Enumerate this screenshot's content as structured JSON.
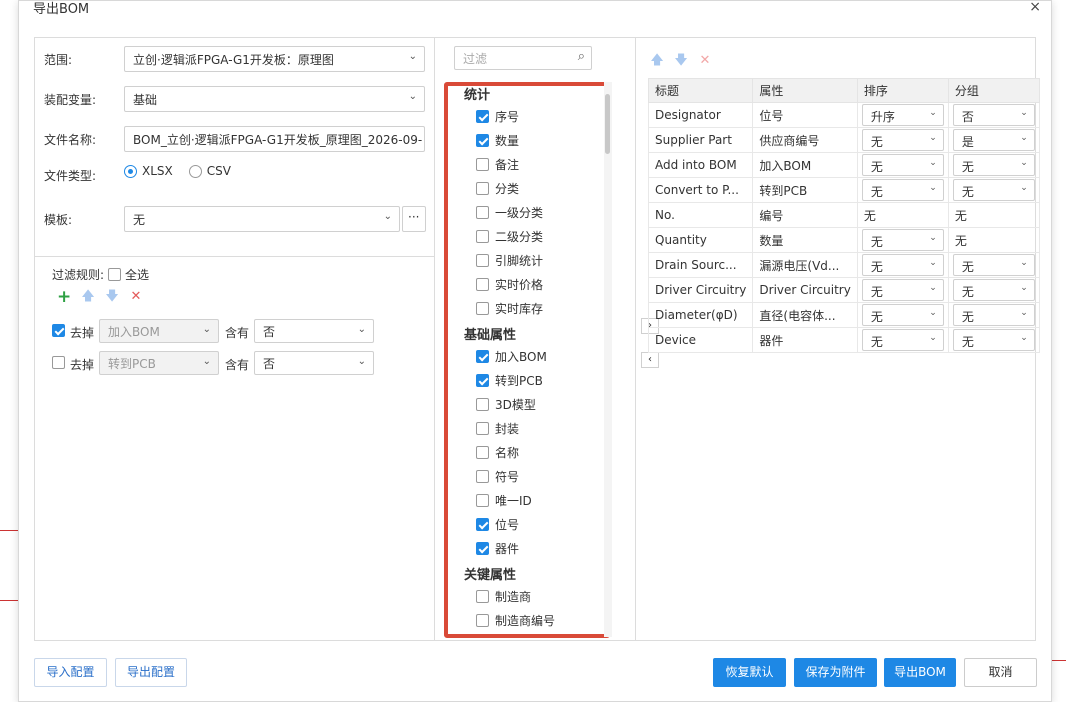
{
  "window": {
    "title": "导出BOM",
    "close_glyph": "×"
  },
  "form": {
    "range_label": "范围:",
    "range_value": "立创·逻辑派FPGA-G1开发板：原理图",
    "variant_label": "装配变量:",
    "variant_value": "基础",
    "filename_label": "文件名称:",
    "filename_value": "BOM_立创·逻辑派FPGA-G1开发板_原理图_2026-09-",
    "filetype_label": "文件类型:",
    "filetype_options": [
      "XLSX",
      "CSV"
    ],
    "filetype_selected": "XLSX",
    "template_label": "模板:",
    "template_value": "无",
    "template_more": "···"
  },
  "filter_rules": {
    "label": "过滤规则:",
    "select_all": "全选",
    "rules": [
      {
        "checked": true,
        "action": "去掉",
        "field": "加入BOM",
        "op": "含有",
        "value": "否"
      },
      {
        "checked": false,
        "action": "去掉",
        "field": "转到PCB",
        "op": "含有",
        "value": "否"
      }
    ]
  },
  "field_list": {
    "search_placeholder": "过滤",
    "groups": [
      {
        "name": "统计",
        "items": [
          {
            "label": "序号",
            "checked": true
          },
          {
            "label": "数量",
            "checked": true
          },
          {
            "label": "备注",
            "checked": false
          },
          {
            "label": "分类",
            "checked": false
          },
          {
            "label": "一级分类",
            "checked": false
          },
          {
            "label": "二级分类",
            "checked": false
          },
          {
            "label": "引脚统计",
            "checked": false
          },
          {
            "label": "实时价格",
            "checked": false
          },
          {
            "label": "实时库存",
            "checked": false
          }
        ]
      },
      {
        "name": "基础属性",
        "items": [
          {
            "label": "加入BOM",
            "checked": true
          },
          {
            "label": "转到PCB",
            "checked": true
          },
          {
            "label": "3D模型",
            "checked": false
          },
          {
            "label": "封装",
            "checked": false
          },
          {
            "label": "名称",
            "checked": false
          },
          {
            "label": "符号",
            "checked": false
          },
          {
            "label": "唯一ID",
            "checked": false
          },
          {
            "label": "位号",
            "checked": true
          },
          {
            "label": "器件",
            "checked": true
          }
        ]
      },
      {
        "name": "关键属性",
        "items": [
          {
            "label": "制造商",
            "checked": false
          },
          {
            "label": "制造商编号",
            "checked": false
          }
        ]
      }
    ]
  },
  "move_buttons": {
    "right": "›",
    "left": "‹"
  },
  "columns_table": {
    "headers": [
      "标题",
      "属性",
      "排序",
      "分组"
    ],
    "rows": [
      {
        "title": "Designator",
        "attr": "位号",
        "sort": "升序",
        "sort_sel": true,
        "group": "否",
        "group_sel": true
      },
      {
        "title": "Supplier Part",
        "attr": "供应商编号",
        "sort": "无",
        "sort_sel": true,
        "group": "是",
        "group_sel": true
      },
      {
        "title": "Add into BOM",
        "attr": "加入BOM",
        "sort": "无",
        "sort_sel": true,
        "group": "无",
        "group_sel": true
      },
      {
        "title": "Convert to P...",
        "attr": "转到PCB",
        "sort": "无",
        "sort_sel": true,
        "group": "无",
        "group_sel": true
      },
      {
        "title": "No.",
        "attr": "编号",
        "sort": "无",
        "sort_sel": false,
        "group": "无",
        "group_sel": false
      },
      {
        "title": "Quantity",
        "attr": "数量",
        "sort": "无",
        "sort_sel": true,
        "group": "无",
        "group_sel": false
      },
      {
        "title": "Drain Sourc...",
        "attr": "漏源电压(Vd...",
        "sort": "无",
        "sort_sel": true,
        "group": "无",
        "group_sel": true
      },
      {
        "title": "Driver Circuitry",
        "attr": "Driver Circuitry",
        "sort": "无",
        "sort_sel": true,
        "group": "无",
        "group_sel": true
      },
      {
        "title": "Diameter(φD)",
        "attr": "直径(电容体...",
        "sort": "无",
        "sort_sel": true,
        "group": "无",
        "group_sel": true
      },
      {
        "title": "Device",
        "attr": "器件",
        "sort": "无",
        "sort_sel": true,
        "group": "无",
        "group_sel": true
      }
    ]
  },
  "footer": {
    "import_config": "导入配置",
    "export_config": "导出配置",
    "restore_default": "恢复默认",
    "save_attachment": "保存为附件",
    "export_bom": "导出BOM",
    "cancel": "取消"
  },
  "colors": {
    "accent": "#1e88e5",
    "highlight_border": "#d94a38",
    "add_green": "#2ea043",
    "delete_red": "#e35a5a"
  }
}
